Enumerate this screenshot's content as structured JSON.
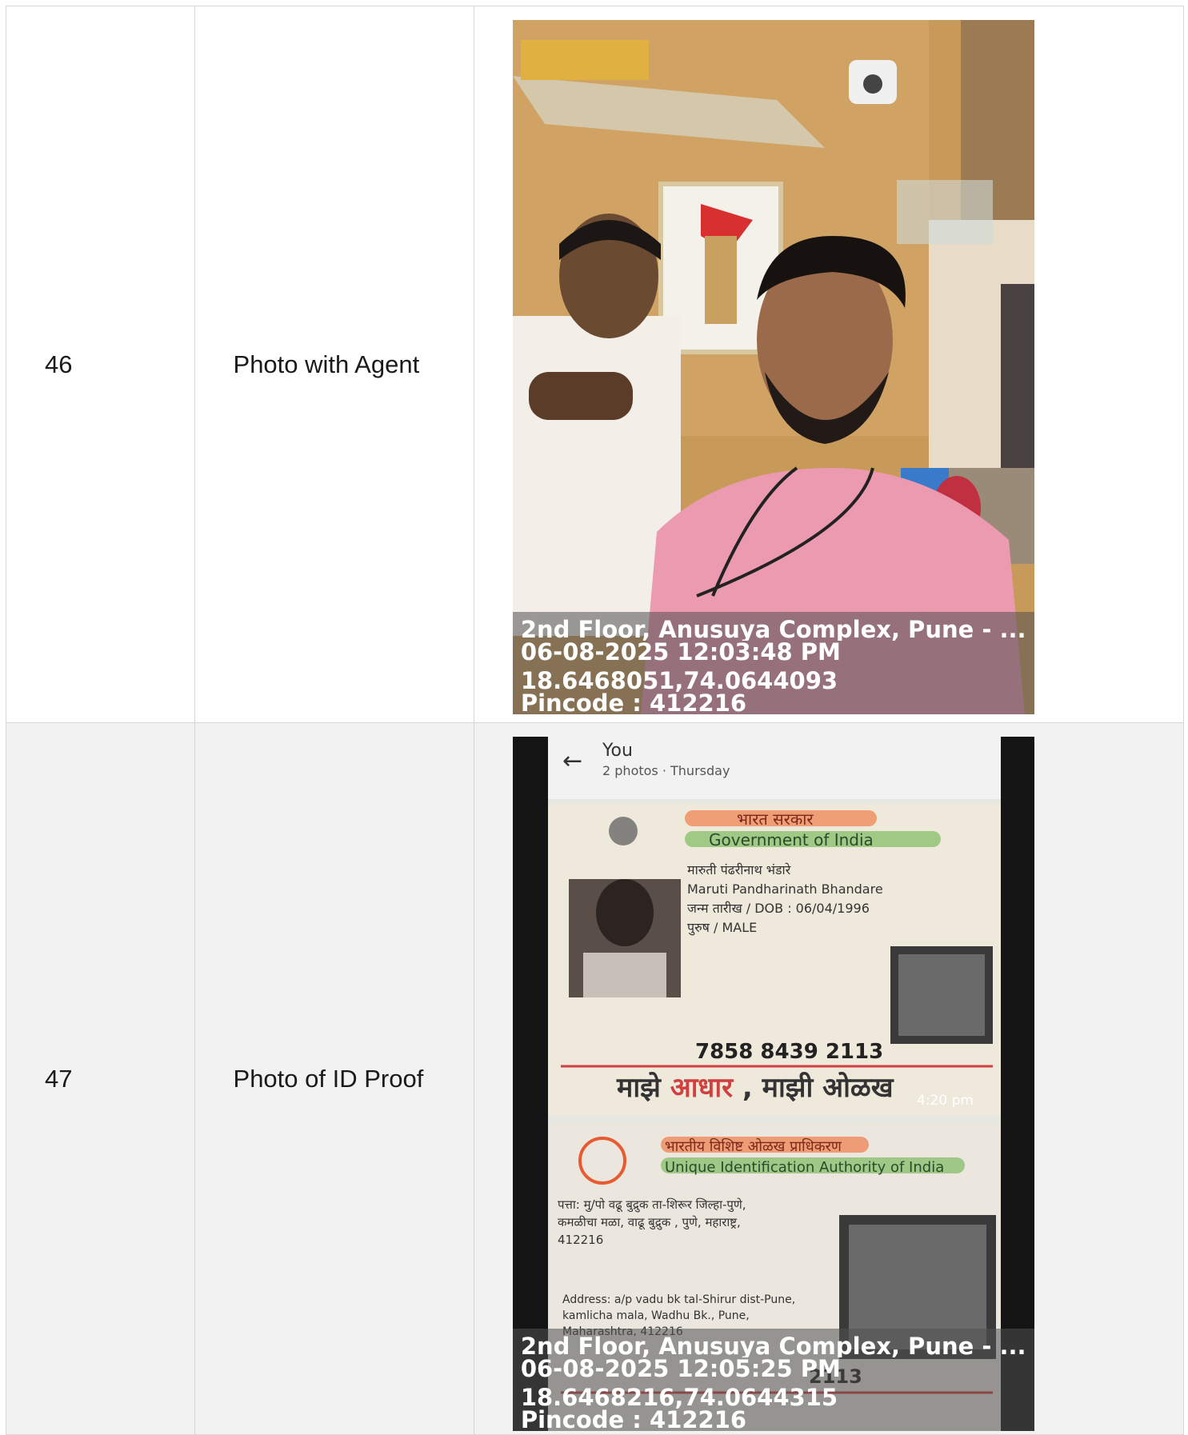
{
  "rows": [
    {
      "num": "46",
      "label": "Photo with Agent",
      "overlay": {
        "address": "2nd Floor, Anusuya Complex, Pune - ...",
        "datetime": "06-08-2025 12:03:48 PM",
        "coords": "18.6468051,74.0644093",
        "pincode": "Pincode : 412216"
      }
    },
    {
      "num": "47",
      "label": "Photo of ID Proof",
      "overlay": {
        "address": "2nd Floor, Anusuya Complex, Pune - ...",
        "datetime": "06-08-2025 12:05:25 PM",
        "coords": "18.6468216,74.0644315",
        "pincode": "Pincode : 412216"
      },
      "chat": {
        "name": "You",
        "meta": "2 photos · Thursday",
        "time": "4:20 pm"
      },
      "id_front": {
        "gov_hi": "भारत सरकार",
        "gov_en": "Government of India",
        "name_hi": "मारुती पंढरीनाथ भंडारे",
        "name_en": "Maruti Pandharinath Bhandare",
        "dob": "जन्म तारीख / DOB : 06/04/1996",
        "gender": "पुरुष / MALE",
        "number": "7858 8439 2113",
        "slogan_a": "माझे",
        "slogan_b": "आधार",
        "slogan_c": ", माझी ओळख"
      },
      "id_back": {
        "uidai_hi": "भारतीय विशिष्ट ओळख प्राधिकरण",
        "uidai_en": "Unique Identification Authority of India",
        "addr_hi1": "पत्ता: मु/पो वढू बुद्रुक ता-शिरूर जिल्हा-पुणे,",
        "addr_hi2": "कमळीचा मळा, वाढू बुद्रुक , पुणे, महाराष्ट्र,",
        "addr_hi3": "412216",
        "addr_en1": "Address: a/p vadu bk tal-Shirur dist-Pune,",
        "addr_en2": "kamlicha mala, Wadhu Bk., Pune,",
        "addr_en3": "Maharashtra, 412216",
        "number_partial": "2113"
      }
    }
  ]
}
